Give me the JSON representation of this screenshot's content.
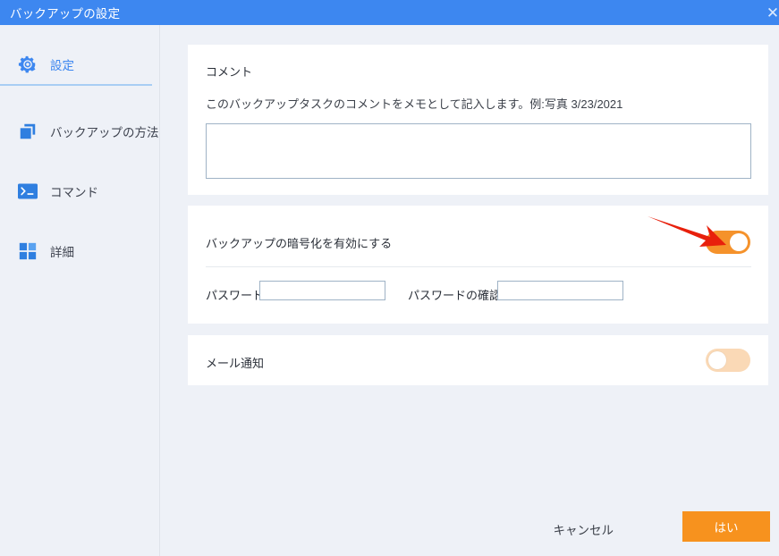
{
  "window": {
    "title": "バックアップの設定",
    "close_icon": "close-icon",
    "titlebar_color": "#3d87f0"
  },
  "sidebar": {
    "items": [
      {
        "label": "設定",
        "icon": "gear-icon",
        "active": true
      },
      {
        "label": "バックアップの方法",
        "icon": "copy-stack-icon",
        "active": false
      },
      {
        "label": "コマンド",
        "icon": "terminal-icon",
        "active": false
      },
      {
        "label": "詳細",
        "icon": "grid-icon",
        "active": false
      }
    ]
  },
  "main": {
    "comment_card": {
      "title": "コメント",
      "description": "このバックアップタスクのコメントをメモとして記入します。例:写真 3/23/2021",
      "textarea_value": "",
      "textarea_placeholder": ""
    },
    "encryption_card": {
      "title": "バックアップの暗号化を有効にする",
      "toggle_state": "on",
      "password_label": "パスワード",
      "password_value": "",
      "confirm_label": "パスワードの確認",
      "confirm_value": ""
    },
    "mail_card": {
      "title": "メール通知",
      "toggle_state": "off"
    }
  },
  "annotation": {
    "arrow_color": "#e8200c",
    "arrow_target": "encryption-toggle"
  },
  "footer": {
    "cancel_label": "キャンセル",
    "confirm_label": "はい",
    "confirm_color": "#f7921e"
  }
}
